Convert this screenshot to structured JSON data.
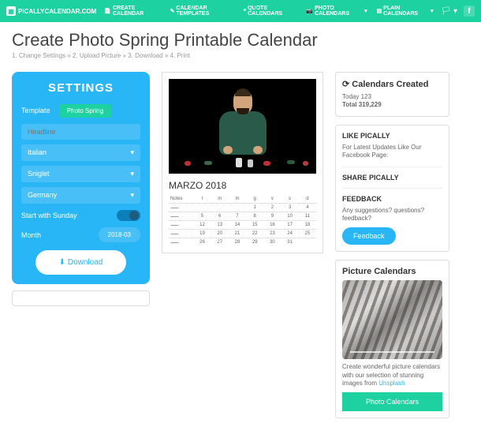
{
  "nav": {
    "logo": "PICALLYCALENDAR.COM",
    "links": [
      "CREATE CALENDAR",
      "CALENDAR TEMPLATES",
      "QUOTE CALENDARS",
      "PHOTO CALENDARS",
      "PLAIN CALENDARS"
    ]
  },
  "page": {
    "title": "Create Photo Spring Printable Calendar",
    "breadcrumb": "1. Change Settings » 2. Upload Picture » 3. Download » 4. Print"
  },
  "settings": {
    "title": "SETTINGS",
    "template_label": "Template",
    "template_value": "Photo Spring",
    "headline_placeholder": "Headline",
    "language": "Italian",
    "font": "Sniglet",
    "country": "Germany",
    "sunday_label": "Start with Sunday",
    "month_label": "Month",
    "month_value": "2018-03",
    "download": "Download"
  },
  "calendar": {
    "title": "MARZO 2018",
    "notes": "Notes",
    "days": [
      "l",
      "m",
      "m",
      "g",
      "v",
      "s",
      "d"
    ],
    "weeks": [
      [
        "",
        "",
        "",
        "1",
        "2",
        "3",
        "4"
      ],
      [
        "5",
        "6",
        "7",
        "8",
        "9",
        "10",
        "11"
      ],
      [
        "12",
        "13",
        "14",
        "15",
        "16",
        "17",
        "18"
      ],
      [
        "19",
        "20",
        "21",
        "22",
        "23",
        "24",
        "25"
      ],
      [
        "26",
        "27",
        "28",
        "29",
        "30",
        "31",
        ""
      ]
    ]
  },
  "sidebar": {
    "created_title": "Calendars Created",
    "today_label": "Today 123",
    "total_label": "Total 319,229",
    "like_title": "LIKE PICALLY",
    "like_text": "For Latest Updates Like Our Facebook Page:",
    "share_title": "SHARE PICALLY",
    "feedback_title": "FEEDBACK",
    "feedback_text": "Any suggestions? questions? feedback?",
    "feedback_btn": "Feedback",
    "pic_title": "Picture Calendars",
    "pic_text": "Create wonderful picture calendars with our selection of stunning images from ",
    "pic_link": "Unsplash",
    "pic_btn": "Photo Calendars"
  }
}
